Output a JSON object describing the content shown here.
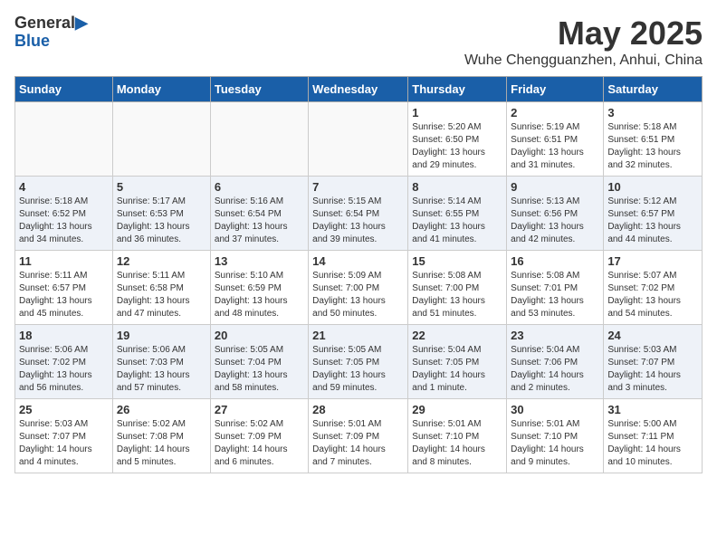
{
  "header": {
    "logo_general": "General",
    "logo_blue": "Blue",
    "title": "May 2025",
    "subtitle": "Wuhe Chengguanzhen, Anhui, China"
  },
  "weekdays": [
    "Sunday",
    "Monday",
    "Tuesday",
    "Wednesday",
    "Thursday",
    "Friday",
    "Saturday"
  ],
  "weeks": [
    {
      "row_alt": false,
      "days": [
        {
          "num": "",
          "info": "",
          "empty": true
        },
        {
          "num": "",
          "info": "",
          "empty": true
        },
        {
          "num": "",
          "info": "",
          "empty": true
        },
        {
          "num": "",
          "info": "",
          "empty": true
        },
        {
          "num": "1",
          "info": "Sunrise: 5:20 AM\nSunset: 6:50 PM\nDaylight: 13 hours\nand 29 minutes.",
          "empty": false
        },
        {
          "num": "2",
          "info": "Sunrise: 5:19 AM\nSunset: 6:51 PM\nDaylight: 13 hours\nand 31 minutes.",
          "empty": false
        },
        {
          "num": "3",
          "info": "Sunrise: 5:18 AM\nSunset: 6:51 PM\nDaylight: 13 hours\nand 32 minutes.",
          "empty": false
        }
      ]
    },
    {
      "row_alt": true,
      "days": [
        {
          "num": "4",
          "info": "Sunrise: 5:18 AM\nSunset: 6:52 PM\nDaylight: 13 hours\nand 34 minutes.",
          "empty": false
        },
        {
          "num": "5",
          "info": "Sunrise: 5:17 AM\nSunset: 6:53 PM\nDaylight: 13 hours\nand 36 minutes.",
          "empty": false
        },
        {
          "num": "6",
          "info": "Sunrise: 5:16 AM\nSunset: 6:54 PM\nDaylight: 13 hours\nand 37 minutes.",
          "empty": false
        },
        {
          "num": "7",
          "info": "Sunrise: 5:15 AM\nSunset: 6:54 PM\nDaylight: 13 hours\nand 39 minutes.",
          "empty": false
        },
        {
          "num": "8",
          "info": "Sunrise: 5:14 AM\nSunset: 6:55 PM\nDaylight: 13 hours\nand 41 minutes.",
          "empty": false
        },
        {
          "num": "9",
          "info": "Sunrise: 5:13 AM\nSunset: 6:56 PM\nDaylight: 13 hours\nand 42 minutes.",
          "empty": false
        },
        {
          "num": "10",
          "info": "Sunrise: 5:12 AM\nSunset: 6:57 PM\nDaylight: 13 hours\nand 44 minutes.",
          "empty": false
        }
      ]
    },
    {
      "row_alt": false,
      "days": [
        {
          "num": "11",
          "info": "Sunrise: 5:11 AM\nSunset: 6:57 PM\nDaylight: 13 hours\nand 45 minutes.",
          "empty": false
        },
        {
          "num": "12",
          "info": "Sunrise: 5:11 AM\nSunset: 6:58 PM\nDaylight: 13 hours\nand 47 minutes.",
          "empty": false
        },
        {
          "num": "13",
          "info": "Sunrise: 5:10 AM\nSunset: 6:59 PM\nDaylight: 13 hours\nand 48 minutes.",
          "empty": false
        },
        {
          "num": "14",
          "info": "Sunrise: 5:09 AM\nSunset: 7:00 PM\nDaylight: 13 hours\nand 50 minutes.",
          "empty": false
        },
        {
          "num": "15",
          "info": "Sunrise: 5:08 AM\nSunset: 7:00 PM\nDaylight: 13 hours\nand 51 minutes.",
          "empty": false
        },
        {
          "num": "16",
          "info": "Sunrise: 5:08 AM\nSunset: 7:01 PM\nDaylight: 13 hours\nand 53 minutes.",
          "empty": false
        },
        {
          "num": "17",
          "info": "Sunrise: 5:07 AM\nSunset: 7:02 PM\nDaylight: 13 hours\nand 54 minutes.",
          "empty": false
        }
      ]
    },
    {
      "row_alt": true,
      "days": [
        {
          "num": "18",
          "info": "Sunrise: 5:06 AM\nSunset: 7:02 PM\nDaylight: 13 hours\nand 56 minutes.",
          "empty": false
        },
        {
          "num": "19",
          "info": "Sunrise: 5:06 AM\nSunset: 7:03 PM\nDaylight: 13 hours\nand 57 minutes.",
          "empty": false
        },
        {
          "num": "20",
          "info": "Sunrise: 5:05 AM\nSunset: 7:04 PM\nDaylight: 13 hours\nand 58 minutes.",
          "empty": false
        },
        {
          "num": "21",
          "info": "Sunrise: 5:05 AM\nSunset: 7:05 PM\nDaylight: 13 hours\nand 59 minutes.",
          "empty": false
        },
        {
          "num": "22",
          "info": "Sunrise: 5:04 AM\nSunset: 7:05 PM\nDaylight: 14 hours\nand 1 minute.",
          "empty": false
        },
        {
          "num": "23",
          "info": "Sunrise: 5:04 AM\nSunset: 7:06 PM\nDaylight: 14 hours\nand 2 minutes.",
          "empty": false
        },
        {
          "num": "24",
          "info": "Sunrise: 5:03 AM\nSunset: 7:07 PM\nDaylight: 14 hours\nand 3 minutes.",
          "empty": false
        }
      ]
    },
    {
      "row_alt": false,
      "days": [
        {
          "num": "25",
          "info": "Sunrise: 5:03 AM\nSunset: 7:07 PM\nDaylight: 14 hours\nand 4 minutes.",
          "empty": false
        },
        {
          "num": "26",
          "info": "Sunrise: 5:02 AM\nSunset: 7:08 PM\nDaylight: 14 hours\nand 5 minutes.",
          "empty": false
        },
        {
          "num": "27",
          "info": "Sunrise: 5:02 AM\nSunset: 7:09 PM\nDaylight: 14 hours\nand 6 minutes.",
          "empty": false
        },
        {
          "num": "28",
          "info": "Sunrise: 5:01 AM\nSunset: 7:09 PM\nDaylight: 14 hours\nand 7 minutes.",
          "empty": false
        },
        {
          "num": "29",
          "info": "Sunrise: 5:01 AM\nSunset: 7:10 PM\nDaylight: 14 hours\nand 8 minutes.",
          "empty": false
        },
        {
          "num": "30",
          "info": "Sunrise: 5:01 AM\nSunset: 7:10 PM\nDaylight: 14 hours\nand 9 minutes.",
          "empty": false
        },
        {
          "num": "31",
          "info": "Sunrise: 5:00 AM\nSunset: 7:11 PM\nDaylight: 14 hours\nand 10 minutes.",
          "empty": false
        }
      ]
    }
  ]
}
